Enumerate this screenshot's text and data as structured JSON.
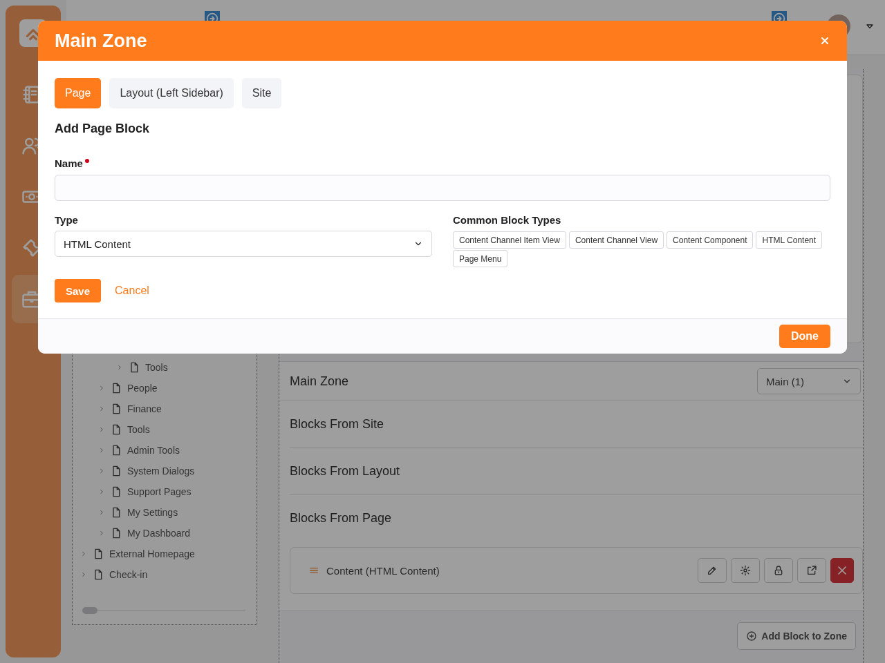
{
  "sidebar": {
    "items": [
      {
        "selected": false
      },
      {
        "selected": false
      },
      {
        "selected": false
      },
      {
        "selected": false
      },
      {
        "selected": true
      }
    ]
  },
  "tree": {
    "items": [
      {
        "children": [
          {
            "children": [
              {
                "label": "Tools",
                "expanded": false
              }
            ]
          },
          {
            "label": "People",
            "expanded": false
          },
          {
            "label": "Finance",
            "expanded": false
          },
          {
            "label": "Tools",
            "expanded": false
          },
          {
            "label": "Admin Tools",
            "expanded": false
          },
          {
            "label": "System Dialogs",
            "expanded": false
          },
          {
            "label": "Support Pages",
            "expanded": false
          },
          {
            "label": "My Settings",
            "expanded": false
          },
          {
            "label": "My Dashboard",
            "expanded": false
          }
        ]
      },
      {
        "label": "External Homepage",
        "expanded": false
      },
      {
        "label": "Check-in",
        "expanded": false
      }
    ]
  },
  "zone": {
    "title": "Main Zone",
    "select": "Main (1)",
    "sections": [
      {
        "title": "Blocks From Site"
      },
      {
        "title": "Blocks From Layout"
      },
      {
        "title": "Blocks From Page",
        "blocks": [
          {
            "label": "Content (HTML Content)"
          }
        ]
      }
    ],
    "add_button": "Add Block to Zone"
  },
  "modal": {
    "title": "Main Zone",
    "tabs": [
      {
        "label": "Page",
        "selected": true
      },
      {
        "label": "Layout (Left Sidebar)",
        "selected": false
      },
      {
        "label": "Site",
        "selected": false
      }
    ],
    "heading": "Add Page Block",
    "name_field": {
      "label": "Name",
      "required": true
    },
    "type_field": {
      "label": "Type",
      "value": "HTML Content"
    },
    "common_types": {
      "label": "Common Block Types",
      "items": [
        "Content Channel Item View",
        "Content Channel View",
        "Content Component",
        "HTML Content",
        "Page Menu"
      ]
    },
    "save": "Save",
    "cancel": "Cancel",
    "done": "Done"
  }
}
